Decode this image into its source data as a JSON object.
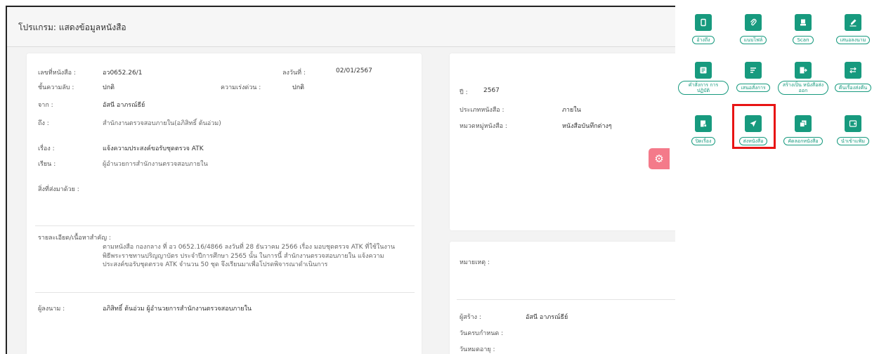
{
  "page": {
    "title": "โปรแกรม: แสดงข้อมูลหนังสือ"
  },
  "doc": {
    "number_label": "เลขที่หนังสือ :",
    "number": "อว0652.26/1",
    "date_label": "ลงวันที่ :",
    "date": "02/01/2567",
    "secrecy_label": "ชั้นความลับ :",
    "secrecy": "ปกติ",
    "urgency_label": "ความเร่งด่วน :",
    "urgency": "ปกติ",
    "from_label": "จาก :",
    "from": "อัสนี อาภรณ์ธีย์",
    "to_label": "ถึง :",
    "to": "สำนักงานตรวจสอบภายใน(อภิสิทธิ์ ต้นอ่วม)",
    "subject_label": "เรื่อง :",
    "subject": "แจ้งความประสงค์ขอรับชุดตรวจ ATK",
    "attn_label": "เรียน :",
    "attn": "ผู้อำนวยการสำนักงานตรวจสอบภายใน",
    "attach_label": "สิ่งที่ส่งมาด้วย :",
    "detail_label": "รายละเอียด/เนื้อหาสำคัญ :",
    "detail_text": "ตามหนังสือ กองกลาง ที่ อว 0652.16/4866 ลงวันที่ 28 ธันวาคม 2566 เรื่อง มอบชุดตรวจ ATK ที่ใช้ในงานพิธีพระราชทานปริญญาบัตร ประจำปีการศึกษา 2565 นั้น ในการนี้ สำนักงานตรวจสอบภายใน แจ้งความประสงค์ขอรับชุดตรวจ ATK จำนวน 50 ชุด จึงเรียนมาเพื่อโปรดพิจารณาดำเนินการ",
    "signer_label": "ผู้ลงนาม :",
    "signer": "อภิสิทธิ์ ต้นอ่วม ผู้อำนวยการสำนักงานตรวจสอบภายใน"
  },
  "meta": {
    "year_label": "ปี :",
    "year": "2567",
    "type_label": "ประเภทหนังสือ :",
    "type": "ภายใน",
    "category_label": "หมวดหมู่หนังสือ :",
    "category": "หนังสือบันทึกต่างๆ"
  },
  "notes": {
    "remark_label": "หมายเหตุ :",
    "creator_label": "ผู้สร้าง :",
    "creator": "อัสนี อาภรณ์ธีย์",
    "due_label": "วันครบกำหนด :",
    "expire_label": "วันหมดอายุ :"
  },
  "actions": [
    {
      "label": "อ้างถึง",
      "icon": "copy-icon"
    },
    {
      "label": "แนบไฟล์",
      "icon": "paperclip-icon"
    },
    {
      "label": "Scan",
      "icon": "scanner-icon"
    },
    {
      "label": "เสนอลงนาม",
      "icon": "signature-icon"
    },
    {
      "label": "คำสั่งการ การปฏิบัติ",
      "icon": "note-icon"
    },
    {
      "label": "เสนอสั่งการ",
      "icon": "order-icon"
    },
    {
      "label": "สร้างเป็น หนังสือส่งออก",
      "icon": "export-icon"
    },
    {
      "label": "คืนเรื่องส่งคืน",
      "icon": "return-icon"
    },
    {
      "label": "ปิดเรื่อง",
      "icon": "folder-close-icon"
    },
    {
      "label": "ส่งหนังสือ",
      "icon": "send-icon"
    },
    {
      "label": "คัดลอกหนังสือ",
      "icon": "duplicate-icon"
    },
    {
      "label": "นำเข้าแฟ้ม",
      "icon": "file-import-icon"
    }
  ],
  "colors": {
    "accent": "#179a7e",
    "highlight": "#e81414",
    "floating": "#f47a8a"
  }
}
